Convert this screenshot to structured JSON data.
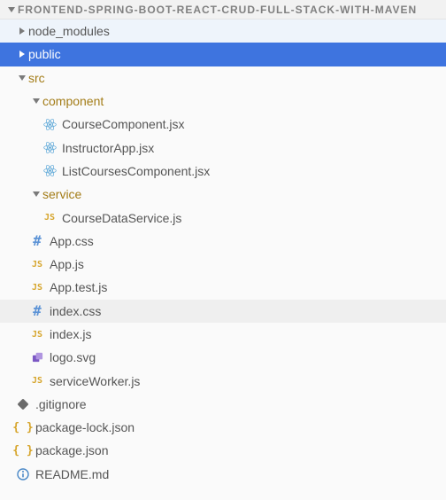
{
  "root": {
    "name": "FRONTEND-SPRING-BOOT-REACT-CRUD-FULL-STACK-WITH-MAVEN"
  },
  "tree": {
    "node_modules": "node_modules",
    "public": "public",
    "src": "src",
    "component": "component",
    "CourseComponent": "CourseComponent.jsx",
    "InstructorApp": "InstructorApp.jsx",
    "ListCoursesComponent": "ListCoursesComponent.jsx",
    "service": "service",
    "CourseDataService": "CourseDataService.js",
    "AppCss": "App.css",
    "AppJs": "App.js",
    "AppTestJs": "App.test.js",
    "indexCss": "index.css",
    "indexJs": "index.js",
    "logoSvg": "logo.svg",
    "serviceWorker": "serviceWorker.js",
    "gitignore": ".gitignore",
    "packageLock": "package-lock.json",
    "packageJson": "package.json",
    "readme": "README.md"
  }
}
